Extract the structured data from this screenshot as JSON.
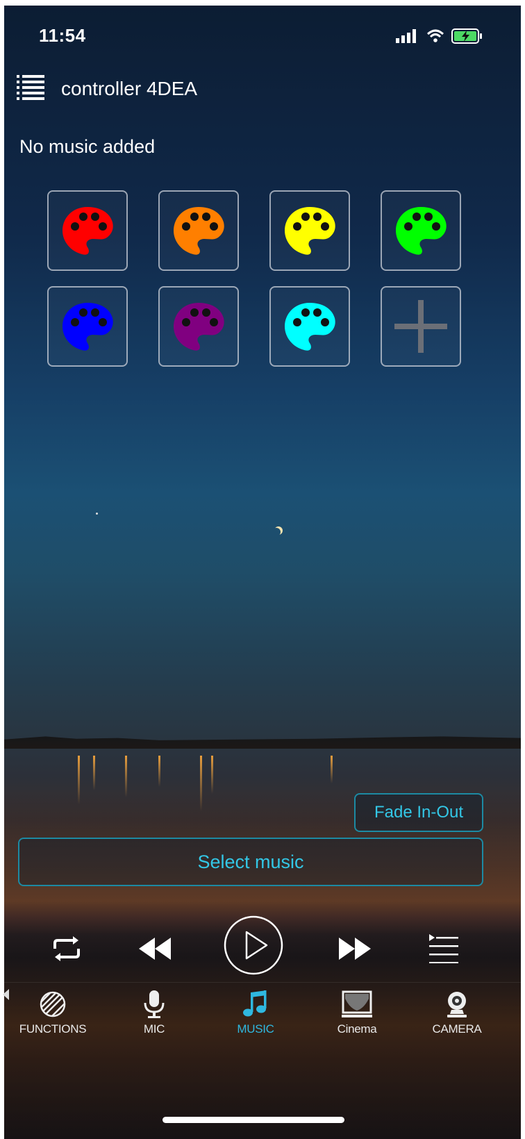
{
  "status": {
    "time": "11:54"
  },
  "header": {
    "title": "controller 4DEA",
    "menu_icon": "list-menu-icon"
  },
  "music": {
    "empty_text": "No music added"
  },
  "palette": {
    "colors": [
      "#ff0000",
      "#ff7f00",
      "#ffff00",
      "#00ff00",
      "#0000ff",
      "#800080",
      "#00ffff"
    ],
    "add_icon": "plus-icon"
  },
  "buttons": {
    "fade": "Fade In-Out",
    "select_music": "Select music"
  },
  "player": {
    "icons": [
      "repeat-icon",
      "rewind-icon",
      "play-icon",
      "fast-forward-icon",
      "playlist-icon"
    ]
  },
  "tabs": [
    {
      "label": "FUNCTIONS",
      "icon": "functions-icon",
      "active": false
    },
    {
      "label": "MIC",
      "icon": "microphone-icon",
      "active": false
    },
    {
      "label": "MUSIC",
      "icon": "music-note-icon",
      "active": true
    },
    {
      "label": "Cinema",
      "icon": "cinema-screen-icon",
      "active": false
    },
    {
      "label": "CAMERA",
      "icon": "camera-icon",
      "active": false
    }
  ],
  "accent_color": "#2fb8e0"
}
